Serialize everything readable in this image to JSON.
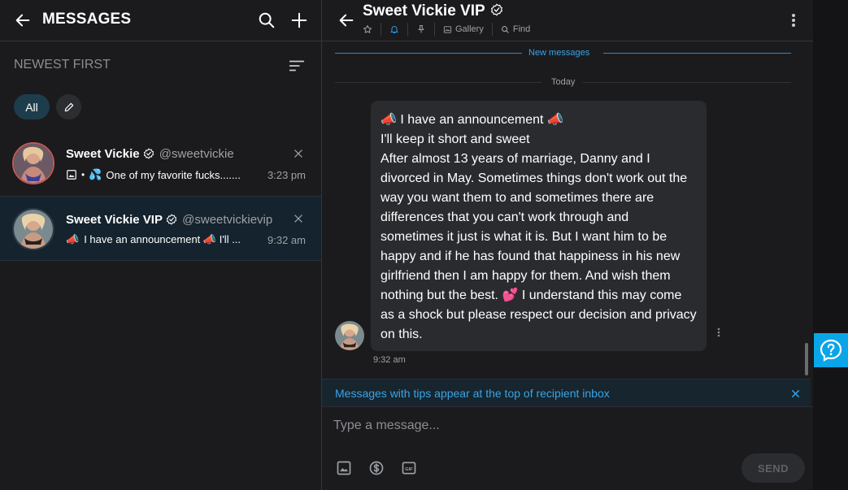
{
  "sidebar": {
    "title": "MESSAGES",
    "sort_label": "NEWEST FIRST",
    "filter_all": "All",
    "chats": [
      {
        "name": "Sweet Vickie",
        "handle": "@sweetvickie",
        "preview": "One of my favorite fucks.......",
        "time": "3:23 pm",
        "preview_emoji": "💦",
        "preview_bullet": "•"
      },
      {
        "name": "Sweet Vickie VIP",
        "handle": "@sweetvickievip",
        "preview": "I have an announcement 📣 I'll ...",
        "time": "9:32 am",
        "preview_emoji": "📣"
      }
    ]
  },
  "conversation": {
    "title": "Sweet Vickie VIP",
    "actions": {
      "gallery": "Gallery",
      "find": "Find"
    },
    "new_messages_label": "New messages",
    "day_label": "Today",
    "message": {
      "lines": [
        "📣 I have an announcement 📣",
        "I'll keep it short and sweet",
        "After almost 13 years of marriage, Danny and I",
        "divorced in May. Sometimes things don't work out the",
        "way you want them to and sometimes there are",
        "differences that you can't work through and",
        "sometimes it just is what it is. But I want him to be",
        "happy and if he has found that happiness in his new",
        "girlfriend then I am happy for them. And wish them",
        "nothing but the best. 💕 I understand this may come",
        "as a shock but please respect our decision and privacy",
        "on this."
      ],
      "time": "9:32 am"
    },
    "tip_banner": "Messages with tips appear at the top of recipient inbox",
    "composer": {
      "placeholder": "Type a message...",
      "send_label": "SEND"
    }
  },
  "colors": {
    "background": "#1b1b1d",
    "accent": "#3aa3e8",
    "selected_row": "#14232d",
    "help_button": "#0aa5e8"
  },
  "icons": [
    "back-arrow-icon",
    "search-icon",
    "plus-icon",
    "sort-icon",
    "pencil-icon",
    "verified-icon",
    "close-icon",
    "image-icon",
    "star-icon",
    "bell-icon",
    "pin-icon",
    "gallery-icon",
    "find-icon",
    "more-vertical-icon",
    "dollar-icon",
    "gif-icon",
    "help-icon"
  ]
}
